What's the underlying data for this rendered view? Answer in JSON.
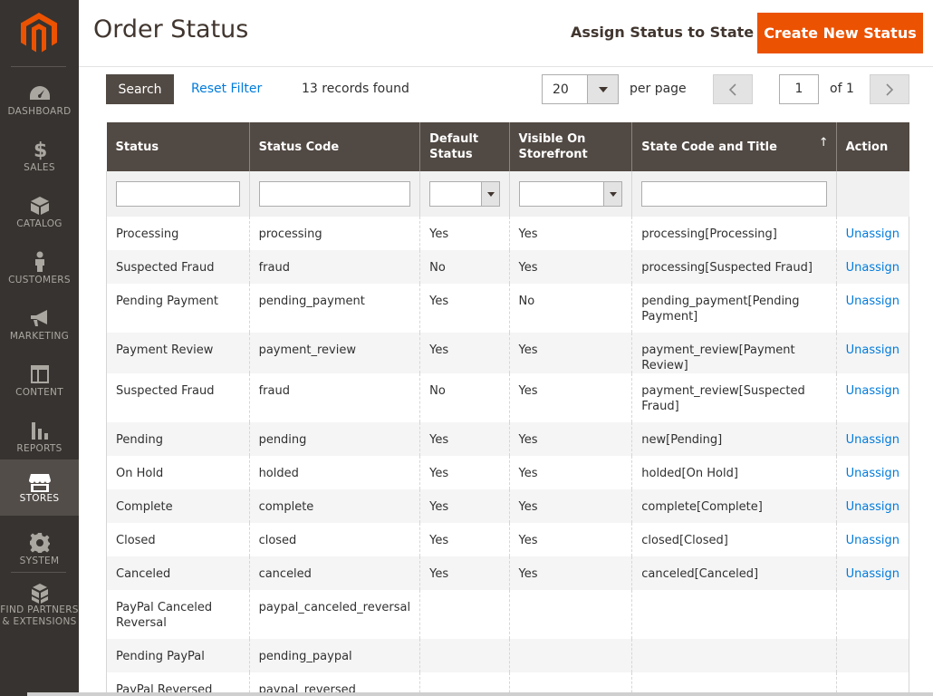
{
  "sidebar": {
    "items": [
      {
        "label": "DASHBOARD",
        "icon": "dashboard-icon"
      },
      {
        "label": "SALES",
        "icon": "dollar-icon"
      },
      {
        "label": "CATALOG",
        "icon": "box-icon"
      },
      {
        "label": "CUSTOMERS",
        "icon": "person-icon"
      },
      {
        "label": "MARKETING",
        "icon": "megaphone-icon"
      },
      {
        "label": "CONTENT",
        "icon": "layout-icon"
      },
      {
        "label": "REPORTS",
        "icon": "bar-chart-icon"
      },
      {
        "label": "STORES",
        "icon": "store-icon"
      },
      {
        "label": "SYSTEM",
        "icon": "gear-icon"
      },
      {
        "label": "FIND PARTNERS & EXTENSIONS",
        "label_line1": "FIND PARTNERS",
        "label_line2": "& EXTENSIONS",
        "icon": "blocks-icon"
      }
    ],
    "active": "STORES"
  },
  "header": {
    "title": "Order Status",
    "assign_label": "Assign Status to State",
    "create_label": "Create New Status"
  },
  "toolbar": {
    "search_label": "Search",
    "reset_label": "Reset Filter",
    "records": "13 records found",
    "per_page_value": "20",
    "per_page_label": "per page",
    "current_page": "1",
    "of_pages": "of 1"
  },
  "table": {
    "columns": [
      "Status",
      "Status Code",
      "Default Status",
      "Visible On Storefront",
      "State Code and Title",
      "Action"
    ],
    "sort_indicator": "↑",
    "rows": [
      {
        "status": "Processing",
        "code": "processing",
        "default": "Yes",
        "visible": "Yes",
        "state": "processing[Processing]",
        "action": "Unassign"
      },
      {
        "status": "Suspected Fraud",
        "code": "fraud",
        "default": "No",
        "visible": "Yes",
        "state": "processing[Suspected Fraud]",
        "action": "Unassign"
      },
      {
        "status": "Pending Payment",
        "code": "pending_payment",
        "default": "Yes",
        "visible": "No",
        "state": "pending_payment[Pending Payment]",
        "action": "Unassign"
      },
      {
        "status": "Payment Review",
        "code": "payment_review",
        "default": "Yes",
        "visible": "Yes",
        "state": "payment_review[Payment Review]",
        "action": "Unassign"
      },
      {
        "status": "Suspected Fraud",
        "code": "fraud",
        "default": "No",
        "visible": "Yes",
        "state": "payment_review[Suspected Fraud]",
        "action": "Unassign"
      },
      {
        "status": "Pending",
        "code": "pending",
        "default": "Yes",
        "visible": "Yes",
        "state": "new[Pending]",
        "action": "Unassign"
      },
      {
        "status": "On Hold",
        "code": "holded",
        "default": "Yes",
        "visible": "Yes",
        "state": "holded[On Hold]",
        "action": "Unassign"
      },
      {
        "status": "Complete",
        "code": "complete",
        "default": "Yes",
        "visible": "Yes",
        "state": "complete[Complete]",
        "action": "Unassign"
      },
      {
        "status": "Closed",
        "code": "closed",
        "default": "Yes",
        "visible": "Yes",
        "state": "closed[Closed]",
        "action": "Unassign"
      },
      {
        "status": "Canceled",
        "code": "canceled",
        "default": "Yes",
        "visible": "Yes",
        "state": "canceled[Canceled]",
        "action": "Unassign"
      },
      {
        "status": "PayPal Canceled Reversal",
        "code": "paypal_canceled_reversal",
        "default": "",
        "visible": "",
        "state": "",
        "action": ""
      },
      {
        "status": "Pending PayPal",
        "code": "pending_paypal",
        "default": "",
        "visible": "",
        "state": "",
        "action": ""
      },
      {
        "status": "PayPal Reversed",
        "code": "paypal_reversed",
        "default": "",
        "visible": "",
        "state": "",
        "action": ""
      }
    ]
  }
}
